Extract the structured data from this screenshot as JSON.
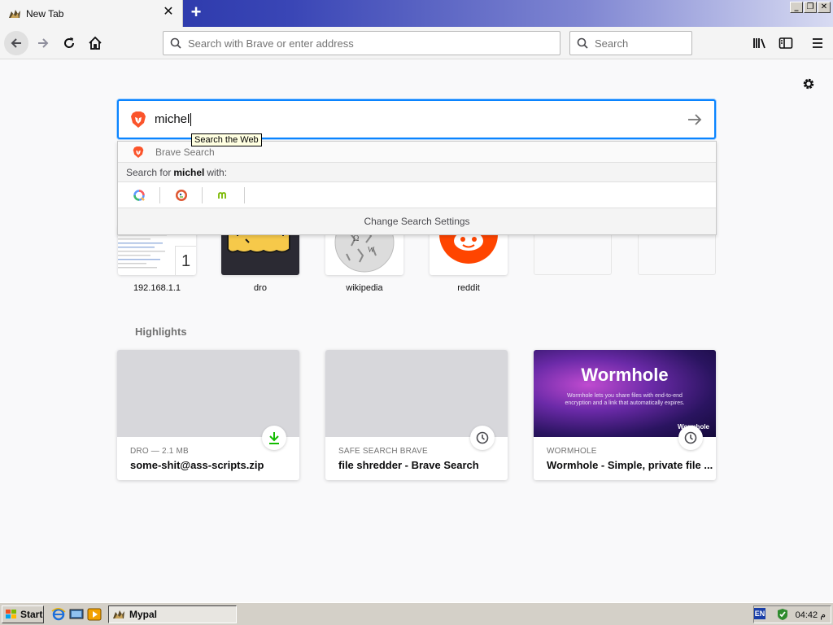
{
  "browser": {
    "tab_title": "New Tab",
    "tab_close": "✕",
    "new_tab": "+",
    "url_placeholder": "Search with Brave or enter address",
    "search_placeholder": "Search"
  },
  "search": {
    "typed": "michel",
    "tooltip": "Search the Web",
    "engine_name": "Brave Search",
    "search_for_prefix": "Search for",
    "search_for_term": "michel",
    "search_for_suffix": "with:",
    "change_settings": "Change Search Settings"
  },
  "top_sites": [
    {
      "label": "192.168.1.1",
      "badge": "1"
    },
    {
      "label": "dro"
    },
    {
      "label": "wikipedia"
    },
    {
      "label": "reddit"
    }
  ],
  "highlights": {
    "title": "Highlights",
    "cards": [
      {
        "meta": "DRO — 2.1 MB",
        "title": "some-shit@ass-scripts.zip",
        "icon": "download-icon"
      },
      {
        "meta": "SAFE SEARCH BRAVE",
        "title": "file shredder - Brave Search",
        "icon": "clock-icon"
      },
      {
        "meta": "WORMHOLE",
        "title": "Wormhole - Simple, private file ...",
        "icon": "clock-icon",
        "image_title": "Wormhole",
        "image_sub": "Wormhole lets you share files with end-to-end encryption and a link that automatically expires.",
        "image_corner": "Wormhole"
      }
    ]
  },
  "taskbar": {
    "start": "Start",
    "task": "Mypal",
    "lang": "EN",
    "clock": "04:42 م"
  },
  "colors": {
    "accent": "#0a84ff",
    "brave_orange": "#fb542b",
    "reddit": "#ff4500",
    "download_green": "#12bc00"
  }
}
